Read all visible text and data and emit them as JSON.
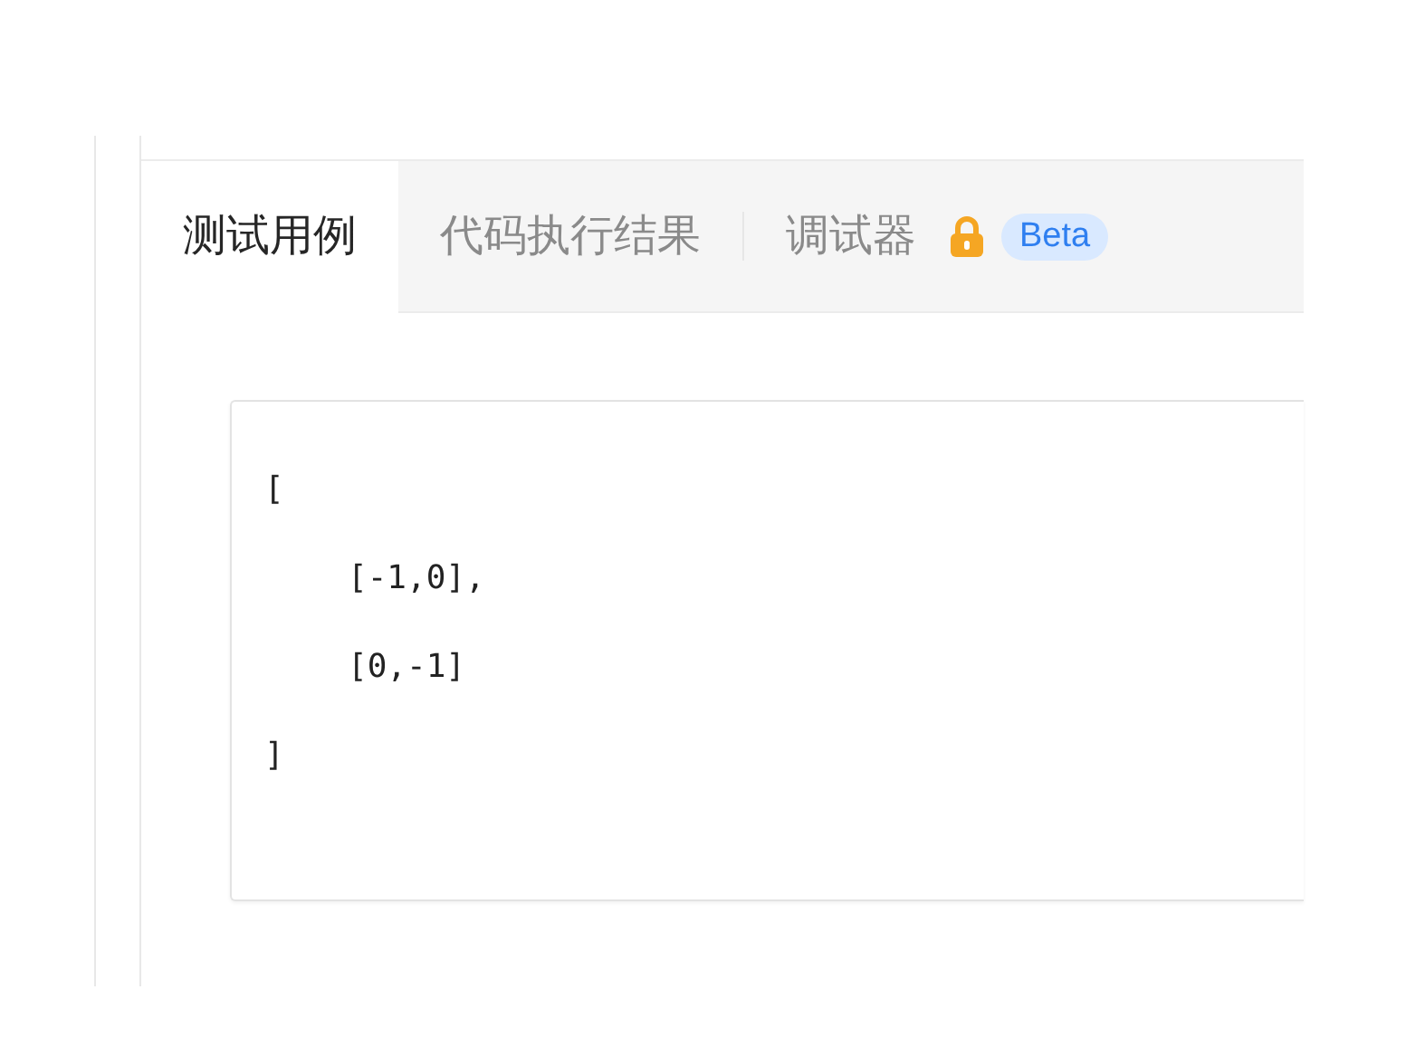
{
  "tabs": [
    {
      "label": "测试用例",
      "selected": true
    },
    {
      "label": "代码执行结果",
      "selected": false
    },
    {
      "label": "调试器",
      "selected": false,
      "locked": true,
      "badge": "Beta"
    }
  ],
  "test_case": {
    "open": "[",
    "items": [
      "[-1,0],",
      "[0,-1]"
    ],
    "close": "]"
  }
}
